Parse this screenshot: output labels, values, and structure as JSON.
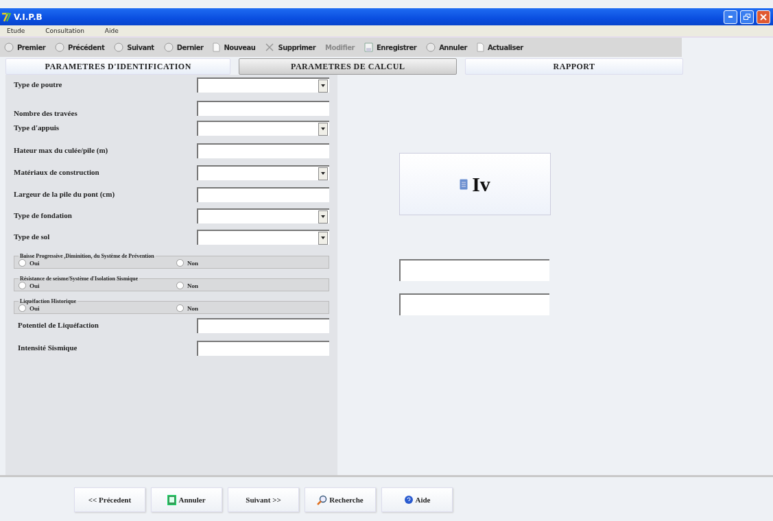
{
  "window": {
    "title": "V.I.P.B"
  },
  "menu": [
    "Etude",
    "Consultation",
    "Aide"
  ],
  "toolbar": [
    {
      "label": "Premier",
      "disabled": false
    },
    {
      "label": "Précédent",
      "disabled": false
    },
    {
      "label": "Suivant",
      "disabled": false
    },
    {
      "label": "Dernier",
      "disabled": false
    },
    {
      "label": "Nouveau",
      "disabled": false
    },
    {
      "label": "Supprimer",
      "disabled": false
    },
    {
      "label": "Modifier",
      "disabled": true
    },
    {
      "label": "Enregistrer",
      "disabled": false
    },
    {
      "label": "Annuler",
      "disabled": false
    },
    {
      "label": "Actualiser",
      "disabled": false
    }
  ],
  "tabs": [
    {
      "label": "PARAMETRES D'IDENTIFICATION",
      "selected": false
    },
    {
      "label": "PARAMETRES DE CALCUL",
      "selected": true
    },
    {
      "label": "RAPPORT",
      "selected": false
    }
  ],
  "fields": [
    {
      "label": "Type de poutre",
      "kind": "combo"
    },
    {
      "label": "Nombre des travées",
      "kind": "text"
    },
    {
      "label": "Type d'appuis",
      "kind": "combo"
    },
    {
      "label": "Hateur max du culée/pile (m)",
      "kind": "text"
    },
    {
      "label": "Matériaux de construction",
      "kind": "combo"
    },
    {
      "label": "Largeur de la pile du pont (cm)",
      "kind": "text"
    },
    {
      "label": "Type de fondation",
      "kind": "combo"
    },
    {
      "label": "Type de sol",
      "kind": "combo"
    }
  ],
  "groups": [
    {
      "title": "Baisse Progressive ,Diminition, du Système de Prévention",
      "options": [
        {
          "label": "Oui",
          "selected": false
        },
        {
          "label": "Non",
          "selected": false
        }
      ]
    },
    {
      "title": "Résistance de seisme/Système d'Isolation Sismique",
      "options": [
        {
          "label": "Oui",
          "selected": false
        },
        {
          "label": "Non",
          "selected": false
        }
      ]
    },
    {
      "title": "Liquéfaction Historique",
      "options": [
        {
          "label": "Oui",
          "selected": false
        },
        {
          "label": "Non",
          "selected": false
        }
      ]
    }
  ],
  "extra_fields": [
    {
      "label": "Potentiel de Liquéfaction"
    },
    {
      "label": "Intensité Sismique"
    }
  ],
  "result_button": {
    "label": "Iv"
  },
  "bottom_buttons": [
    {
      "label": "<< Précedent"
    },
    {
      "label": "Annuler"
    },
    {
      "label": "Suivant >>"
    },
    {
      "label": "Recherche"
    },
    {
      "label": "Aide"
    }
  ]
}
